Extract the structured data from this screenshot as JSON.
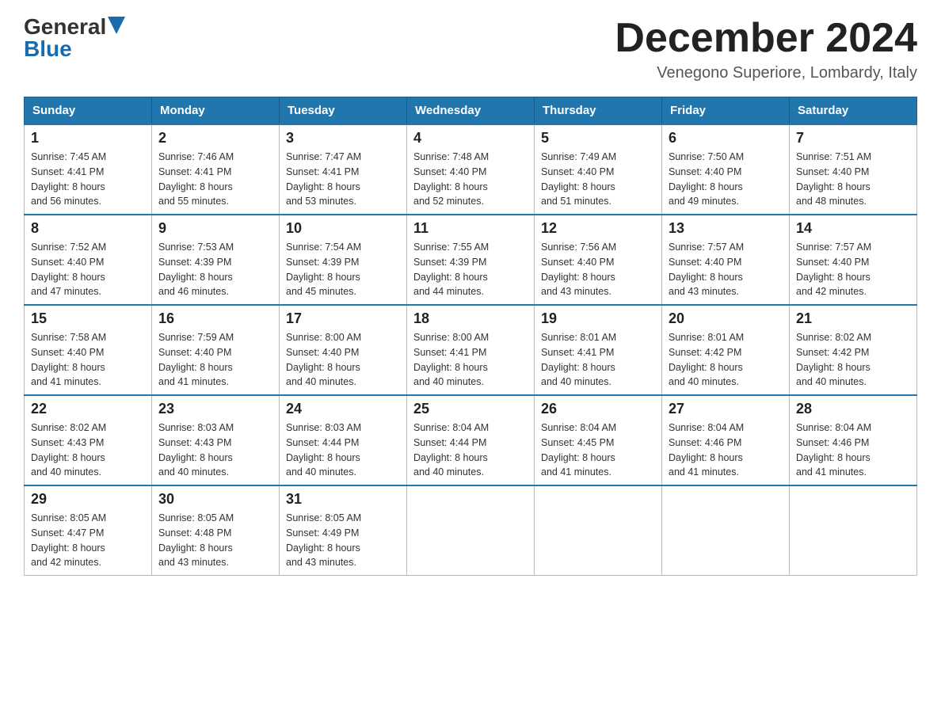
{
  "header": {
    "logo_general": "General",
    "logo_blue": "Blue",
    "month_title": "December 2024",
    "location": "Venegono Superiore, Lombardy, Italy"
  },
  "days_of_week": [
    "Sunday",
    "Monday",
    "Tuesday",
    "Wednesday",
    "Thursday",
    "Friday",
    "Saturday"
  ],
  "weeks": [
    [
      {
        "day": "1",
        "sunrise": "7:45 AM",
        "sunset": "4:41 PM",
        "daylight": "8 hours and 56 minutes."
      },
      {
        "day": "2",
        "sunrise": "7:46 AM",
        "sunset": "4:41 PM",
        "daylight": "8 hours and 55 minutes."
      },
      {
        "day": "3",
        "sunrise": "7:47 AM",
        "sunset": "4:41 PM",
        "daylight": "8 hours and 53 minutes."
      },
      {
        "day": "4",
        "sunrise": "7:48 AM",
        "sunset": "4:40 PM",
        "daylight": "8 hours and 52 minutes."
      },
      {
        "day": "5",
        "sunrise": "7:49 AM",
        "sunset": "4:40 PM",
        "daylight": "8 hours and 51 minutes."
      },
      {
        "day": "6",
        "sunrise": "7:50 AM",
        "sunset": "4:40 PM",
        "daylight": "8 hours and 49 minutes."
      },
      {
        "day": "7",
        "sunrise": "7:51 AM",
        "sunset": "4:40 PM",
        "daylight": "8 hours and 48 minutes."
      }
    ],
    [
      {
        "day": "8",
        "sunrise": "7:52 AM",
        "sunset": "4:40 PM",
        "daylight": "8 hours and 47 minutes."
      },
      {
        "day": "9",
        "sunrise": "7:53 AM",
        "sunset": "4:39 PM",
        "daylight": "8 hours and 46 minutes."
      },
      {
        "day": "10",
        "sunrise": "7:54 AM",
        "sunset": "4:39 PM",
        "daylight": "8 hours and 45 minutes."
      },
      {
        "day": "11",
        "sunrise": "7:55 AM",
        "sunset": "4:39 PM",
        "daylight": "8 hours and 44 minutes."
      },
      {
        "day": "12",
        "sunrise": "7:56 AM",
        "sunset": "4:40 PM",
        "daylight": "8 hours and 43 minutes."
      },
      {
        "day": "13",
        "sunrise": "7:57 AM",
        "sunset": "4:40 PM",
        "daylight": "8 hours and 43 minutes."
      },
      {
        "day": "14",
        "sunrise": "7:57 AM",
        "sunset": "4:40 PM",
        "daylight": "8 hours and 42 minutes."
      }
    ],
    [
      {
        "day": "15",
        "sunrise": "7:58 AM",
        "sunset": "4:40 PM",
        "daylight": "8 hours and 41 minutes."
      },
      {
        "day": "16",
        "sunrise": "7:59 AM",
        "sunset": "4:40 PM",
        "daylight": "8 hours and 41 minutes."
      },
      {
        "day": "17",
        "sunrise": "8:00 AM",
        "sunset": "4:40 PM",
        "daylight": "8 hours and 40 minutes."
      },
      {
        "day": "18",
        "sunrise": "8:00 AM",
        "sunset": "4:41 PM",
        "daylight": "8 hours and 40 minutes."
      },
      {
        "day": "19",
        "sunrise": "8:01 AM",
        "sunset": "4:41 PM",
        "daylight": "8 hours and 40 minutes."
      },
      {
        "day": "20",
        "sunrise": "8:01 AM",
        "sunset": "4:42 PM",
        "daylight": "8 hours and 40 minutes."
      },
      {
        "day": "21",
        "sunrise": "8:02 AM",
        "sunset": "4:42 PM",
        "daylight": "8 hours and 40 minutes."
      }
    ],
    [
      {
        "day": "22",
        "sunrise": "8:02 AM",
        "sunset": "4:43 PM",
        "daylight": "8 hours and 40 minutes."
      },
      {
        "day": "23",
        "sunrise": "8:03 AM",
        "sunset": "4:43 PM",
        "daylight": "8 hours and 40 minutes."
      },
      {
        "day": "24",
        "sunrise": "8:03 AM",
        "sunset": "4:44 PM",
        "daylight": "8 hours and 40 minutes."
      },
      {
        "day": "25",
        "sunrise": "8:04 AM",
        "sunset": "4:44 PM",
        "daylight": "8 hours and 40 minutes."
      },
      {
        "day": "26",
        "sunrise": "8:04 AM",
        "sunset": "4:45 PM",
        "daylight": "8 hours and 41 minutes."
      },
      {
        "day": "27",
        "sunrise": "8:04 AM",
        "sunset": "4:46 PM",
        "daylight": "8 hours and 41 minutes."
      },
      {
        "day": "28",
        "sunrise": "8:04 AM",
        "sunset": "4:46 PM",
        "daylight": "8 hours and 41 minutes."
      }
    ],
    [
      {
        "day": "29",
        "sunrise": "8:05 AM",
        "sunset": "4:47 PM",
        "daylight": "8 hours and 42 minutes."
      },
      {
        "day": "30",
        "sunrise": "8:05 AM",
        "sunset": "4:48 PM",
        "daylight": "8 hours and 43 minutes."
      },
      {
        "day": "31",
        "sunrise": "8:05 AM",
        "sunset": "4:49 PM",
        "daylight": "8 hours and 43 minutes."
      },
      null,
      null,
      null,
      null
    ]
  ],
  "labels": {
    "sunrise": "Sunrise:",
    "sunset": "Sunset:",
    "daylight": "Daylight:"
  }
}
